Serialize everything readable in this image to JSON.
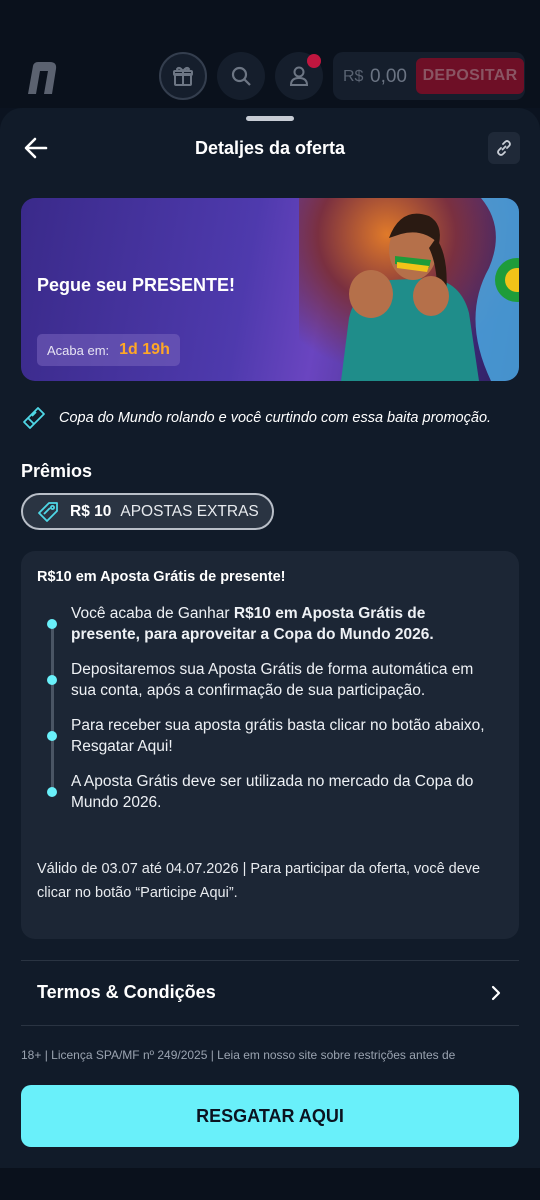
{
  "header": {
    "currency": "R$",
    "balance": "0,00",
    "deposit_label": "DEPOSITAR",
    "icons": [
      "logo-icon",
      "gift-icon",
      "search-icon",
      "user-icon"
    ]
  },
  "sheet": {
    "title": "Detaljes da oferta",
    "back_icon": "arrow-left-icon",
    "link_icon": "link-icon"
  },
  "banner": {
    "title": "Pegue seu PRESENTE!",
    "timer_label": "Acaba em:",
    "timer_value": "1d 19h"
  },
  "description": "Copa do Mundo rolando e você curtindo com essa baita promoção.",
  "prizes": {
    "heading": "Prêmios",
    "chip_amount": "R$ 10",
    "chip_text": "APOSTAS EXTRAS"
  },
  "details": {
    "title": "R$10 em Aposta Grátis de presente!",
    "items": [
      {
        "prefix": "Você acaba de Ganhar ",
        "bold": "R$10 em Aposta Grátis de presente, para aproveitar a Copa do Mundo 2026."
      },
      {
        "prefix": "Depositaremos sua Aposta Grátis de forma automática em sua conta, após a confirmação de sua participação.",
        "bold": ""
      },
      {
        "prefix": "Para receber sua aposta grátis basta clicar no botão abaixo, Resgatar Aqui!",
        "bold": ""
      },
      {
        "prefix": "A Aposta Grátis deve ser utilizada no mercado da Copa do Mundo 2026.",
        "bold": ""
      }
    ],
    "validity": "Válido de 03.07 até 04.07.2026 | Para participar da oferta, você deve clicar no botão “Participe Aqui”."
  },
  "terms_label": "Termos & Condições",
  "legal": "18+ | Licença SPA/MF nº 249/2025 | Leia em nosso site sobre restrições antes de",
  "cta_label": "RESGATAR AQUI",
  "colors": {
    "accent": "#69f0fa",
    "timer": "#ffa726",
    "deposit": "#6e0f26",
    "background": "#111b29"
  }
}
